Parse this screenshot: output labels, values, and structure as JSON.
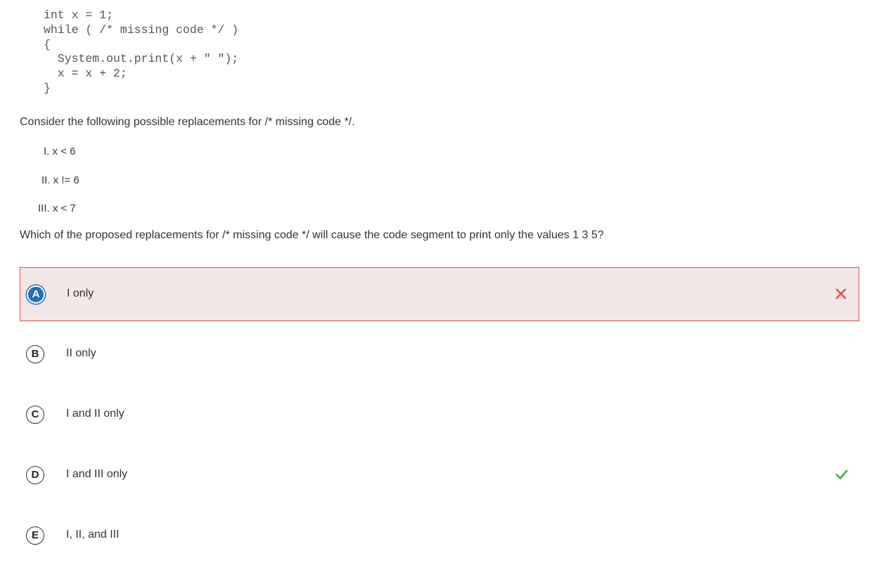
{
  "code": {
    "lines": [
      "int x = 1;",
      "while ( /* missing code */ )",
      "{",
      "  System.out.print(x + \" \");",
      "  x = x + 2;",
      "}"
    ]
  },
  "question": {
    "intro": "Consider the following possible replacements for /* missing code */.",
    "options": [
      "I. x < 6",
      "II. x != 6",
      "III. x < 7"
    ],
    "prompt": "Which of the proposed replacements for /* missing code */ will cause the code segment to print only the values 1 3 5?"
  },
  "choices": [
    {
      "letter": "A",
      "label": "I only",
      "state": "selected-incorrect",
      "mark_icon": "x-icon"
    },
    {
      "letter": "B",
      "label": "II only",
      "state": "none"
    },
    {
      "letter": "C",
      "label": "I and II only",
      "state": "none"
    },
    {
      "letter": "D",
      "label": "I and III only",
      "state": "correct",
      "mark_icon": "check-icon"
    },
    {
      "letter": "E",
      "label": "I, II, and III",
      "state": "none"
    }
  ],
  "colors": {
    "selected_bg": "#f3e6e6",
    "selected_border": "#d9534f",
    "selected_badge": "#1f6fb8",
    "incorrect_mark": "#d9534f",
    "correct_mark": "#4caf50"
  }
}
